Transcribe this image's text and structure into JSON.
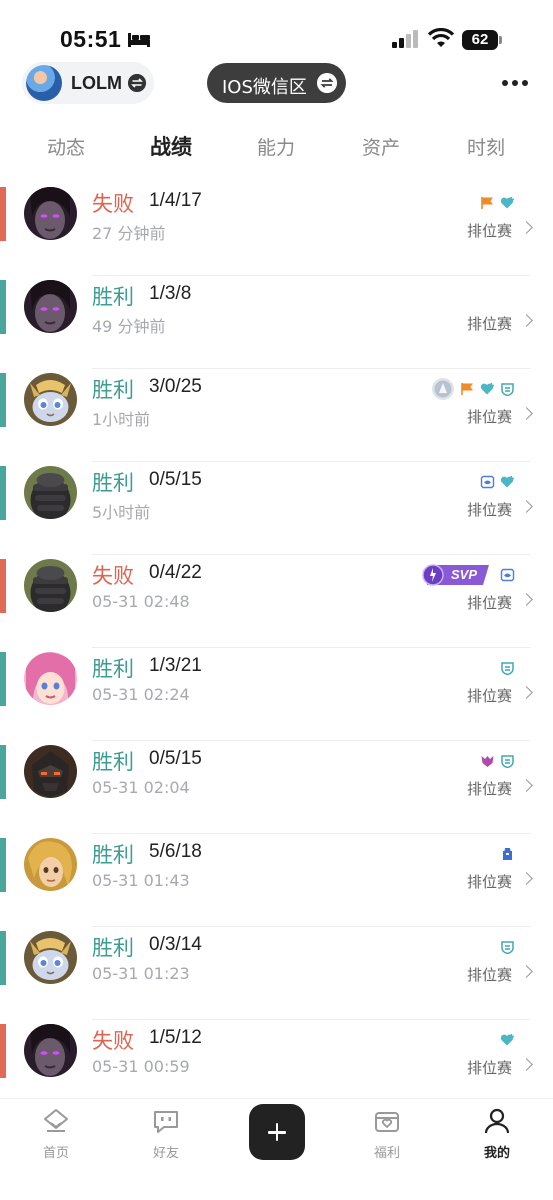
{
  "status_bar": {
    "time": "05:51",
    "battery": "62"
  },
  "header": {
    "account_name": "LOLM",
    "region_name": "IOS微信区"
  },
  "tabs": [
    {
      "label": "动态",
      "active": false
    },
    {
      "label": "战绩",
      "active": true
    },
    {
      "label": "能力",
      "active": false
    },
    {
      "label": "资产",
      "active": false
    },
    {
      "label": "时刻",
      "active": false
    }
  ],
  "matches": [
    {
      "result": "失败",
      "outcome": "lose",
      "kda": "1/4/17",
      "time": "27 分钟前",
      "mode": "排位赛",
      "champion": "dark-mage",
      "badges": [
        "flag-icon",
        "heart-icon"
      ]
    },
    {
      "result": "胜利",
      "outcome": "win",
      "kda": "1/3/8",
      "time": "49 分钟前",
      "mode": "排位赛",
      "champion": "dark-mage",
      "badges": []
    },
    {
      "result": "胜利",
      "outcome": "win",
      "kda": "3/0/25",
      "time": "1小时前",
      "mode": "排位赛",
      "champion": "yordle-cat",
      "badges": [
        "rank-medal-icon",
        "flag-icon",
        "heart-icon",
        "shield-icon"
      ]
    },
    {
      "result": "胜利",
      "outcome": "win",
      "kda": "0/5/15",
      "time": "5小时前",
      "mode": "排位赛",
      "champion": "hooded-tank",
      "badges": [
        "vision-icon",
        "heart-icon"
      ]
    },
    {
      "result": "失败",
      "outcome": "lose",
      "kda": "0/4/22",
      "time": "05-31 02:48",
      "mode": "排位赛",
      "champion": "hooded-tank",
      "badges": [
        "svp-badge",
        "vision-icon"
      ],
      "svp_label": "SVP"
    },
    {
      "result": "胜利",
      "outcome": "win",
      "kda": "1/3/21",
      "time": "05-31 02:24",
      "mode": "排位赛",
      "champion": "pink-idol",
      "badges": [
        "shield-icon"
      ]
    },
    {
      "result": "胜利",
      "outcome": "win",
      "kda": "0/5/15",
      "time": "05-31 02:04",
      "mode": "排位赛",
      "champion": "armored-knight",
      "badges": [
        "demon-icon",
        "shield-icon"
      ]
    },
    {
      "result": "胜利",
      "outcome": "win",
      "kda": "5/6/18",
      "time": "05-31 01:43",
      "mode": "排位赛",
      "champion": "golden-warrior",
      "badges": [
        "tower-icon"
      ]
    },
    {
      "result": "胜利",
      "outcome": "win",
      "kda": "0/3/14",
      "time": "05-31 01:23",
      "mode": "排位赛",
      "champion": "yordle-cat",
      "badges": [
        "shield-icon"
      ]
    },
    {
      "result": "失败",
      "outcome": "lose",
      "kda": "1/5/12",
      "time": "05-31 00:59",
      "mode": "排位赛",
      "champion": "dark-mage",
      "badges": [
        "heart-icon"
      ]
    }
  ],
  "bottom_nav": [
    {
      "label": "首页",
      "icon": "home-icon",
      "active": false
    },
    {
      "label": "好友",
      "icon": "chat-icon",
      "active": false
    },
    {
      "label": "",
      "icon": "plus-icon",
      "active": false
    },
    {
      "label": "福利",
      "icon": "gift-icon",
      "active": false
    },
    {
      "label": "我的",
      "icon": "profile-icon",
      "active": true
    }
  ],
  "colors": {
    "win": "#4aa69a",
    "lose": "#e06a56"
  }
}
